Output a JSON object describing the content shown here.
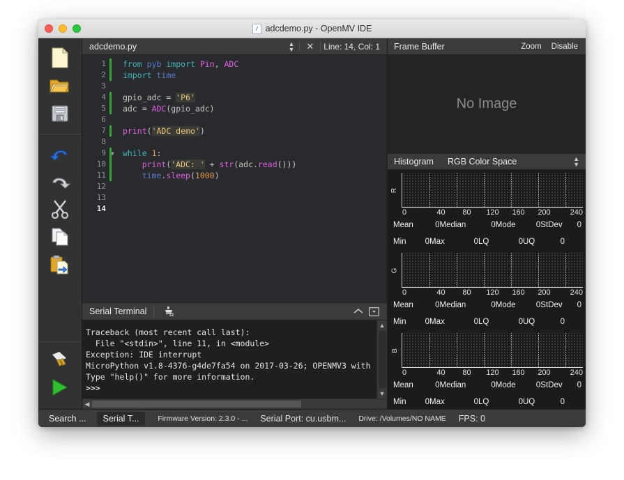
{
  "window": {
    "title": "adcdemo.py - OpenMV IDE",
    "doc_icon": "python-file-icon",
    "traffic_lights": [
      "close",
      "minimize",
      "maximize"
    ]
  },
  "toolbar": {
    "items": [
      {
        "name": "new-file-icon",
        "label": "New File"
      },
      {
        "name": "open-file-icon",
        "label": "Open File"
      },
      {
        "name": "save-file-icon",
        "label": "Save File"
      },
      {
        "name": "undo-icon",
        "label": "Undo"
      },
      {
        "name": "redo-icon",
        "label": "Redo"
      },
      {
        "name": "cut-icon",
        "label": "Cut"
      },
      {
        "name": "copy-icon",
        "label": "Copy"
      },
      {
        "name": "paste-icon",
        "label": "Paste"
      },
      {
        "name": "connect-icon",
        "label": "Connect"
      },
      {
        "name": "run-icon",
        "label": "Run"
      }
    ]
  },
  "editor": {
    "tab_name": "adcdemo.py",
    "close_label": "✕",
    "line_col": "Line: 14, Col: 1",
    "cursor_line": 14,
    "total_lines": 14,
    "line_numbers": [
      "1",
      "2",
      "3",
      "4",
      "5",
      "6",
      "7",
      "8",
      "9",
      "10",
      "11",
      "12",
      "13",
      "14"
    ],
    "modified_lines": [
      1,
      2,
      4,
      5,
      7,
      9,
      10,
      11
    ],
    "fold_line": 9,
    "code_lines": [
      "from pyb import Pin, ADC",
      "import time",
      "",
      "gpio_adc = 'P6'",
      "adc = ADC(gpio_adc)",
      "",
      "print('ADC demo')",
      "",
      "while 1:",
      "    print('ADC: ' + str(adc.read()))",
      "    time.sleep(1000)",
      "",
      "",
      ""
    ]
  },
  "terminal": {
    "title": "Serial Terminal",
    "clear_icon": "clear-terminal-icon",
    "collapse_icon": "collapse-chevron-icon",
    "detach_icon": "detach-panel-icon",
    "lines": [
      "Traceback (most recent call last):",
      "  File \"<stdin>\", line 11, in <module>",
      "Exception: IDE interrupt",
      "MicroPython v1.8-4376-g4de7fa54 on 2017-03-26; OPENMV3 with",
      "Type \"help()\" for more information.",
      ">>>"
    ]
  },
  "frame_buffer": {
    "title": "Frame Buffer",
    "zoom_label": "Zoom",
    "disable_label": "Disable",
    "placeholder": "No Image"
  },
  "histogram": {
    "title": "Histogram",
    "color_space": "RGB Color Space",
    "axis_ticks": [
      "0",
      "40",
      "80",
      "120",
      "160",
      "200",
      "240"
    ],
    "channels": [
      {
        "label": "R",
        "stats_row1": [
          {
            "label": "Mean",
            "value": "0"
          },
          {
            "label": "Median",
            "value": "0"
          },
          {
            "label": "Mode",
            "value": "0"
          },
          {
            "label": "StDev",
            "value": "0"
          }
        ],
        "stats_row2": [
          {
            "label": "Min",
            "value": "0"
          },
          {
            "label": "Max",
            "value": "0"
          },
          {
            "label": "LQ",
            "value": "0"
          },
          {
            "label": "UQ",
            "value": "0"
          }
        ]
      },
      {
        "label": "G",
        "stats_row1": [
          {
            "label": "Mean",
            "value": "0"
          },
          {
            "label": "Median",
            "value": "0"
          },
          {
            "label": "Mode",
            "value": "0"
          },
          {
            "label": "StDev",
            "value": "0"
          }
        ],
        "stats_row2": [
          {
            "label": "Min",
            "value": "0"
          },
          {
            "label": "Max",
            "value": "0"
          },
          {
            "label": "LQ",
            "value": "0"
          },
          {
            "label": "UQ",
            "value": "0"
          }
        ]
      },
      {
        "label": "B",
        "stats_row1": [
          {
            "label": "Mean",
            "value": "0"
          },
          {
            "label": "Median",
            "value": "0"
          },
          {
            "label": "Mode",
            "value": "0"
          },
          {
            "label": "StDev",
            "value": "0"
          }
        ],
        "stats_row2": [
          {
            "label": "Min",
            "value": "0"
          },
          {
            "label": "Max",
            "value": "0"
          },
          {
            "label": "LQ",
            "value": "0"
          },
          {
            "label": "UQ",
            "value": "0"
          }
        ]
      }
    ]
  },
  "statusbar": {
    "search_button": "Search ...",
    "serial_button": "Serial T...",
    "firmware": "Firmware Version: 2.3.0 - ...",
    "serial_port": "Serial Port: cu.usbm...",
    "drive": "Drive: /Volumes/NO NAME",
    "fps": "FPS: 0"
  },
  "chart_data": {
    "type": "bar",
    "title": "Histogram - RGB Color Space",
    "xlabel": "",
    "ylabel": "",
    "xlim": [
      0,
      255
    ],
    "ylim": [
      0,
      1
    ],
    "grid": true,
    "legend": "none",
    "categories": [
      "0",
      "40",
      "80",
      "120",
      "160",
      "200",
      "240"
    ],
    "series": [
      {
        "name": "R",
        "values": [
          0,
          0,
          0,
          0,
          0,
          0,
          0
        ]
      },
      {
        "name": "G",
        "values": [
          0,
          0,
          0,
          0,
          0,
          0,
          0
        ]
      },
      {
        "name": "B",
        "values": [
          0,
          0,
          0,
          0,
          0,
          0,
          0
        ]
      }
    ]
  },
  "colors": {
    "accent_green": "#3ba53b",
    "keyword": "#3fb5b5",
    "function": "#e45ee4",
    "string": "#e8c477",
    "number": "#e79c4e",
    "editor_bg": "#282a2e",
    "panel_bg": "#3b3b3b"
  }
}
